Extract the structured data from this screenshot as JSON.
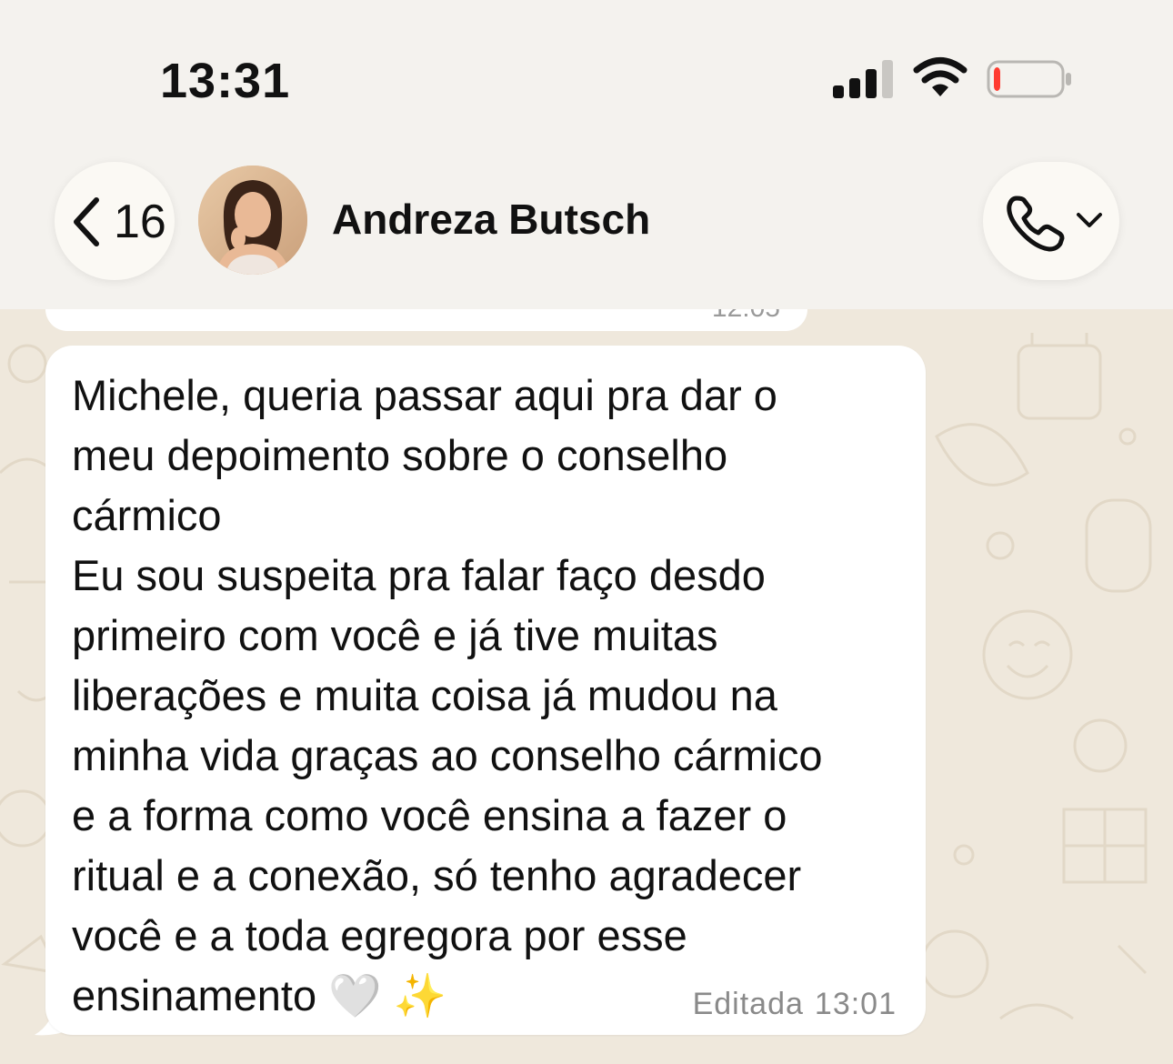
{
  "status_bar": {
    "time": "13:31",
    "signal_icon": "signal-bars-icon",
    "wifi_icon": "wifi-icon",
    "battery_icon": "battery-low-icon",
    "battery_level": 0.1,
    "battery_color": "#ff3b30"
  },
  "header": {
    "back_icon": "chevron-left-icon",
    "unread_count": "16",
    "contact_name": "Andreza Butsch",
    "call_icon": "phone-icon",
    "call_menu_icon": "chevron-down-icon"
  },
  "chat": {
    "previous_message_time": "12:05",
    "message": {
      "text": "Michele, queria passar aqui pra dar o\nmeu depoimento sobre o conselho\ncármico\nEu sou suspeita pra falar faço desdo\nprimeiro com você e já tive muitas\nliberações e muita coisa já mudou na\nminha vida graças ao conselho cármico\ne a forma como você ensina a fazer o\nritual e a conexão, só tenho agradecer\nvocê e a toda egregora por esse\nensinamento 🤍 ✨",
      "edited_label": "Editada",
      "time": "13:01"
    }
  },
  "colors": {
    "header_bg": "#f4f2ee",
    "chat_bg": "#efe8dc",
    "bubble_bg": "#ffffff"
  }
}
